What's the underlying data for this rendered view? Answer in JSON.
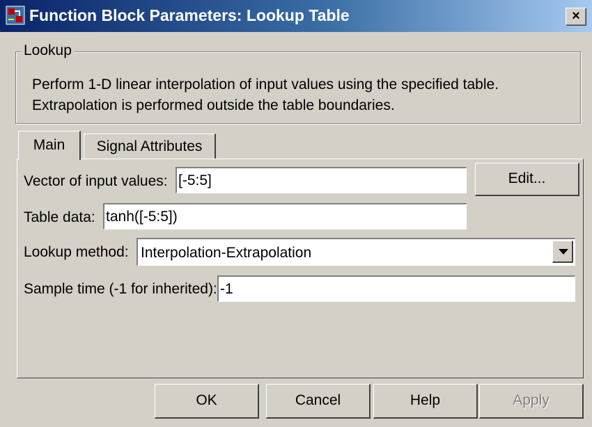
{
  "window": {
    "title": "Function Block Parameters: Lookup Table",
    "close_label": "×"
  },
  "group": {
    "legend": "Lookup",
    "description_line1": "Perform 1-D linear interpolation of input values using the specified table.",
    "description_line2": "Extrapolation is performed outside the table boundaries."
  },
  "tabs": {
    "main": "Main",
    "signal_attributes": "Signal Attributes"
  },
  "params": {
    "input_values_label": "Vector of input values:",
    "input_values_value": "[-5:5]",
    "edit_label": "Edit...",
    "table_data_label": "Table data:",
    "table_data_value": "tanh([-5:5])",
    "lookup_method_label": "Lookup method:",
    "lookup_method_value": "Interpolation-Extrapolation",
    "sample_time_label": "Sample time (-1 for inherited):",
    "sample_time_value": "-1"
  },
  "buttons": {
    "ok": "OK",
    "cancel": "Cancel",
    "help": "Help",
    "apply": "Apply"
  }
}
